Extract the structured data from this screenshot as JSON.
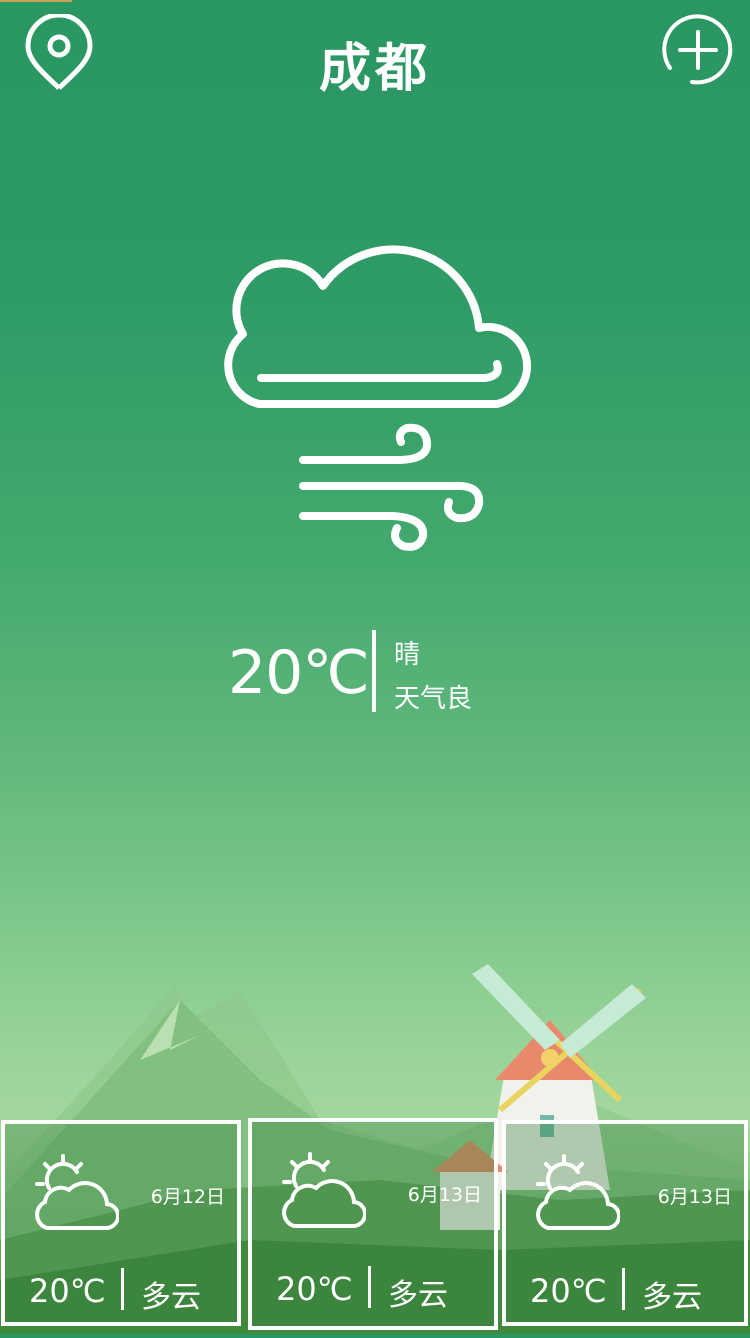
{
  "header": {
    "city": "成都",
    "location_icon": "location-pin-icon",
    "add_icon": "add-city-icon"
  },
  "current": {
    "icon": "cloud-wind-icon",
    "temperature": "20℃",
    "condition": "晴",
    "air_quality": "天气良"
  },
  "forecast": [
    {
      "icon": "partly-cloudy-icon",
      "date": "6月12日",
      "temperature": "20℃",
      "condition": "多云"
    },
    {
      "icon": "partly-cloudy-icon",
      "date": "6月13日",
      "temperature": "20℃",
      "condition": "多云"
    },
    {
      "icon": "partly-cloudy-icon",
      "date": "6月13日",
      "temperature": "20℃",
      "condition": "多云"
    }
  ],
  "colors": {
    "background_top": "#2a9762",
    "background_mid": "#7cc689",
    "foreground": "#ffffff"
  }
}
